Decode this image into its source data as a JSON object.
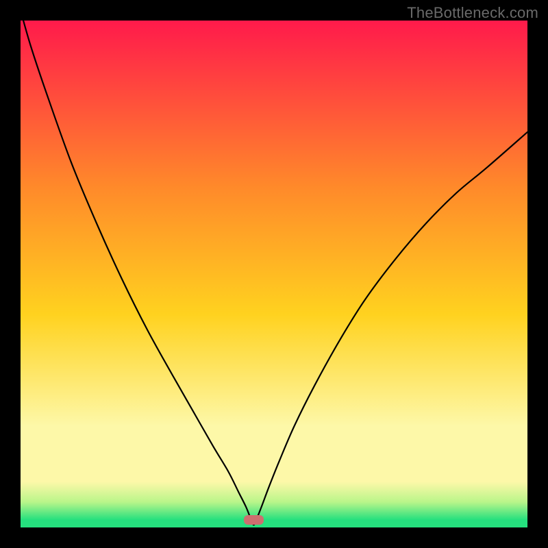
{
  "watermark": {
    "text": "TheBottleneck.com"
  },
  "colors": {
    "top": "#ff1a4b",
    "upper_mid": "#ff8a2a",
    "mid": "#ffd21f",
    "pale": "#fdf8a8",
    "green_light": "#b9f58a",
    "green": "#25e07e",
    "curve": "#000000",
    "marker": "#cd6f6f",
    "frame": "#000000"
  },
  "chart_data": {
    "type": "line",
    "title": "",
    "xlabel": "",
    "ylabel": "",
    "xlim": [
      0,
      100
    ],
    "ylim": [
      0,
      100
    ],
    "curve": {
      "x": [
        0,
        2,
        5,
        10,
        15,
        20,
        25,
        30,
        34,
        38,
        41,
        43,
        44.5,
        45.5,
        46,
        46.5,
        47.5,
        49,
        51,
        54,
        58,
        63,
        68,
        74,
        80,
        86,
        92,
        100
      ],
      "y": [
        102,
        95,
        86,
        72,
        60,
        49,
        39,
        30,
        23,
        16,
        11,
        7,
        4,
        1.5,
        0.5,
        1.5,
        4,
        8,
        13,
        20,
        28,
        37,
        45,
        53,
        60,
        66,
        71,
        78
      ]
    },
    "minimum_marker": {
      "x": 46,
      "y": 1.5,
      "width": 4,
      "height": 2
    },
    "gradient_stops": [
      {
        "pos": 0.0,
        "color": "#ff1a4b"
      },
      {
        "pos": 0.33,
        "color": "#ff8a2a"
      },
      {
        "pos": 0.58,
        "color": "#ffd21f"
      },
      {
        "pos": 0.8,
        "color": "#fdf8a8"
      },
      {
        "pos": 0.91,
        "color": "#fdf8a8"
      },
      {
        "pos": 0.95,
        "color": "#b9f58a"
      },
      {
        "pos": 0.985,
        "color": "#25e07e"
      },
      {
        "pos": 1.0,
        "color": "#25e07e"
      }
    ]
  }
}
